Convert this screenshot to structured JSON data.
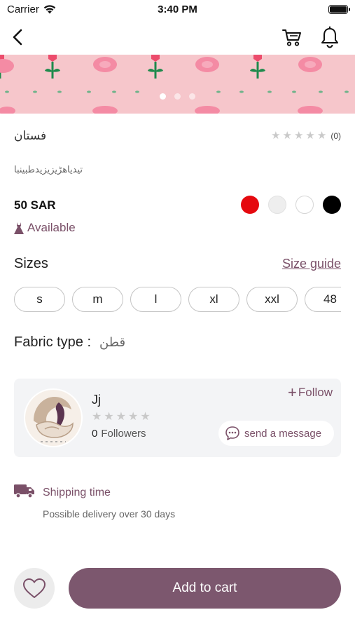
{
  "status_bar": {
    "carrier": "Carrier",
    "time": "3:40 PM"
  },
  "nav": {
    "back_icon": "chevron-left-icon",
    "cart_icon": "cart-icon",
    "bell_icon": "bell-icon"
  },
  "gallery": {
    "image_count": 3,
    "active_index": 0,
    "pattern_icon": "pink-flower-pattern"
  },
  "product": {
    "title": "فستان",
    "rating_count": "(0)",
    "rating_value": 0,
    "description": "تيدياهڑيزيزيدطبينبا",
    "price": "50 SAR",
    "availability": "Available",
    "colors": [
      "#e5090f",
      "#eeeeee",
      "#ffffff",
      "#000000"
    ]
  },
  "sizes": {
    "title": "Sizes",
    "guide_label": "Size guide",
    "options": [
      "s",
      "m",
      "l",
      "xl",
      "xxl",
      "48"
    ]
  },
  "fabric": {
    "label": "Fabric type :",
    "value": "قطن"
  },
  "seller": {
    "name": "Jj",
    "rating_value": 0,
    "followers_count": "0",
    "followers_label": "Followers",
    "follow_label": "Follow",
    "message_label": "send a message"
  },
  "shipping": {
    "title": "Shipping time",
    "subtitle": "Possible delivery over 30 days"
  },
  "actions": {
    "add_to_cart": "Add to cart"
  },
  "theme": {
    "accent": "#7c576e",
    "banner": "#f6c6cb"
  }
}
